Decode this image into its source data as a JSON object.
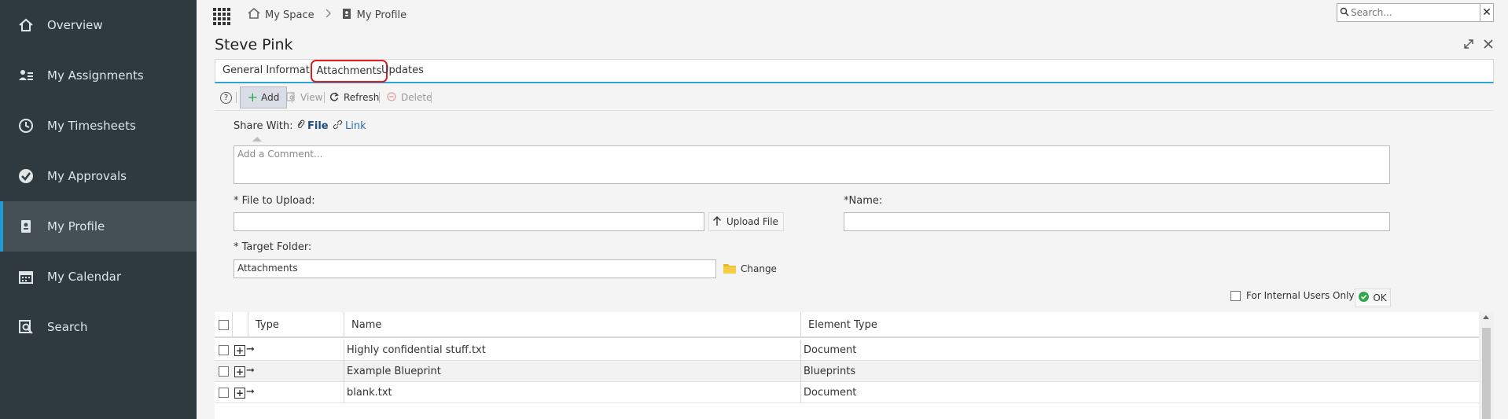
{
  "sidebar": {
    "items": [
      {
        "label": "Overview",
        "icon": "home-icon"
      },
      {
        "label": "My Assignments",
        "icon": "assignments-icon"
      },
      {
        "label": "My Timesheets",
        "icon": "timesheets-icon"
      },
      {
        "label": "My Approvals",
        "icon": "approvals-icon"
      },
      {
        "label": "My Profile",
        "icon": "profile-icon",
        "active": true
      },
      {
        "label": "My Calendar",
        "icon": "calendar-icon"
      },
      {
        "label": "Search",
        "icon": "search-icon"
      }
    ]
  },
  "breadcrumb": {
    "home": "My Space",
    "current": "My Profile"
  },
  "search": {
    "placeholder": "Search...",
    "close": "✕"
  },
  "page": {
    "title": "Steve Pink"
  },
  "tabs": {
    "general": "General Information",
    "attachments": "Attachments",
    "updates": "Updates"
  },
  "toolbar": {
    "help": "?",
    "add": "Add",
    "view": "View",
    "refresh": "Refresh",
    "delete": "Delete"
  },
  "form": {
    "share_with_label": "Share With:",
    "share_file": "File",
    "share_link": "Link",
    "comment_placeholder": "Add a Comment...",
    "file_upload_label": "* File to Upload:",
    "upload_button": "Upload File",
    "name_label": "*Name:",
    "target_folder_label": "* Target Folder:",
    "target_folder_value": "Attachments",
    "change_button": "Change",
    "internal_only_label": "For Internal Users Only",
    "ok_button": "OK"
  },
  "table": {
    "headers": {
      "type": "Type",
      "name": "Name",
      "element_type": "Element Type"
    },
    "rows": [
      {
        "name": "Highly confidential stuff.txt",
        "element_type": "Document"
      },
      {
        "name": "Example Blueprint",
        "element_type": "Blueprints"
      },
      {
        "name": "blank.txt",
        "element_type": "Document"
      }
    ]
  },
  "colors": {
    "sidebar_bg": "#2e3a40",
    "active_accent": "#1f9bd6",
    "highlight_ring": "#e01f1f",
    "link": "#2a6ebb",
    "ok_green": "#2fa84f"
  }
}
